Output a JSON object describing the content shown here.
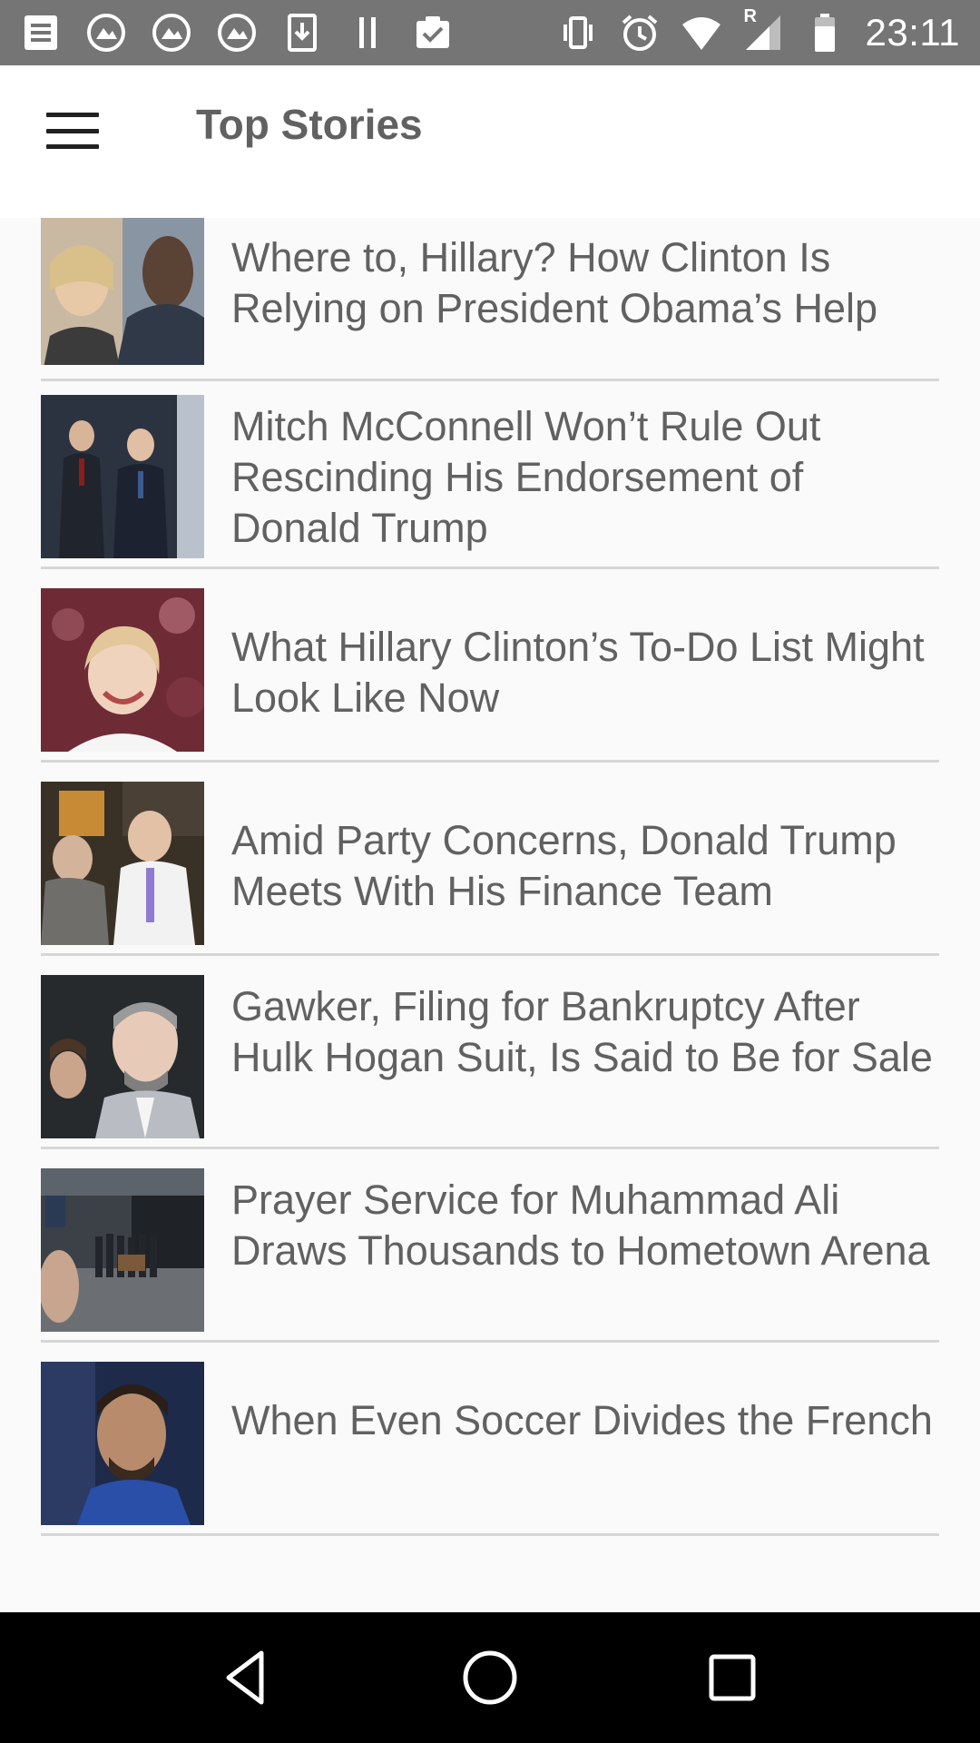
{
  "status_bar": {
    "time": "23:11",
    "left_icons": [
      "document-icon",
      "gallery-icon",
      "gallery-icon",
      "gallery-icon",
      "download-icon",
      "pause-icon",
      "clipboard-check-icon"
    ],
    "right_icons": [
      "vibrate-icon",
      "alarm-icon",
      "wifi-icon",
      "signal-roaming-icon",
      "battery-icon"
    ],
    "signal_label": "R"
  },
  "app_bar": {
    "title": "Top Stories"
  },
  "stories": [
    {
      "headline": "Where to, Hillary? How Clinton Is Relying on President Obama’s Help"
    },
    {
      "headline": "Mitch McConnell Won’t Rule Out Rescinding His Endorsement of Donald Trump"
    },
    {
      "headline": "What Hillary Clinton’s To-Do List Might Look Like Now"
    },
    {
      "headline": "Amid Party Concerns, Donald Trump Meets With His Finance Team"
    },
    {
      "headline": "Gawker, Filing for Bankruptcy After Hulk Hogan Suit, Is Said to Be for Sale"
    },
    {
      "headline": "Prayer Service for Muhammad Ali Draws Thousands to Hometown Arena"
    },
    {
      "headline": "When Even Soccer Divides the French"
    }
  ],
  "nav_bar": {
    "icons": [
      "back-icon",
      "home-icon",
      "recents-icon"
    ]
  },
  "colors": {
    "status_bar": "#757575",
    "app_bar": "#ffffff",
    "headline_text": "#616161",
    "divider": "#d6d6d6",
    "nav_bar": "#000000"
  }
}
